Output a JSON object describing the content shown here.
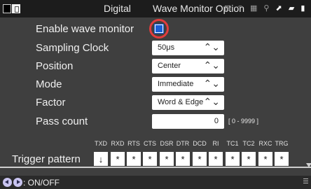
{
  "header": {
    "mode": "Digital",
    "title": "Wave Monitor Option"
  },
  "icons": {
    "battery": "battery-icon",
    "wifi": "wifi-icon",
    "usb": "usb-icon",
    "bluetooth": "bluetooth-icon"
  },
  "settings": {
    "enable_wave_monitor": {
      "label": "Enable wave monitor",
      "checked": true
    },
    "sampling_clock": {
      "label": "Sampling Clock",
      "value": "50μs"
    },
    "position": {
      "label": "Position",
      "value": "Center"
    },
    "mode": {
      "label": "Mode",
      "value": "Immediate"
    },
    "factor": {
      "label": "Factor",
      "value": "Word & Edge"
    },
    "pass_count": {
      "label": "Pass count",
      "value": "0",
      "range": "[ 0 - 9999 ]"
    }
  },
  "trigger": {
    "label": "Trigger pattern",
    "signals": [
      "TXD",
      "RXD",
      "RTS",
      "CTS",
      "DSR",
      "DTR",
      "DCD",
      "RI",
      "TC1",
      "TC2",
      "RXC",
      "TRG"
    ],
    "values": [
      "↓",
      "*",
      "*",
      "*",
      "*",
      "*",
      "*",
      "*",
      "*",
      "*",
      "*",
      "*"
    ]
  },
  "footer": {
    "hint": ": ON/OFF"
  },
  "colors": {
    "background": "#3f3f3f",
    "header_bg": "#1c1c1c",
    "checkbox": "#1a5ed6",
    "highlight_ring": "#e23c3c"
  }
}
